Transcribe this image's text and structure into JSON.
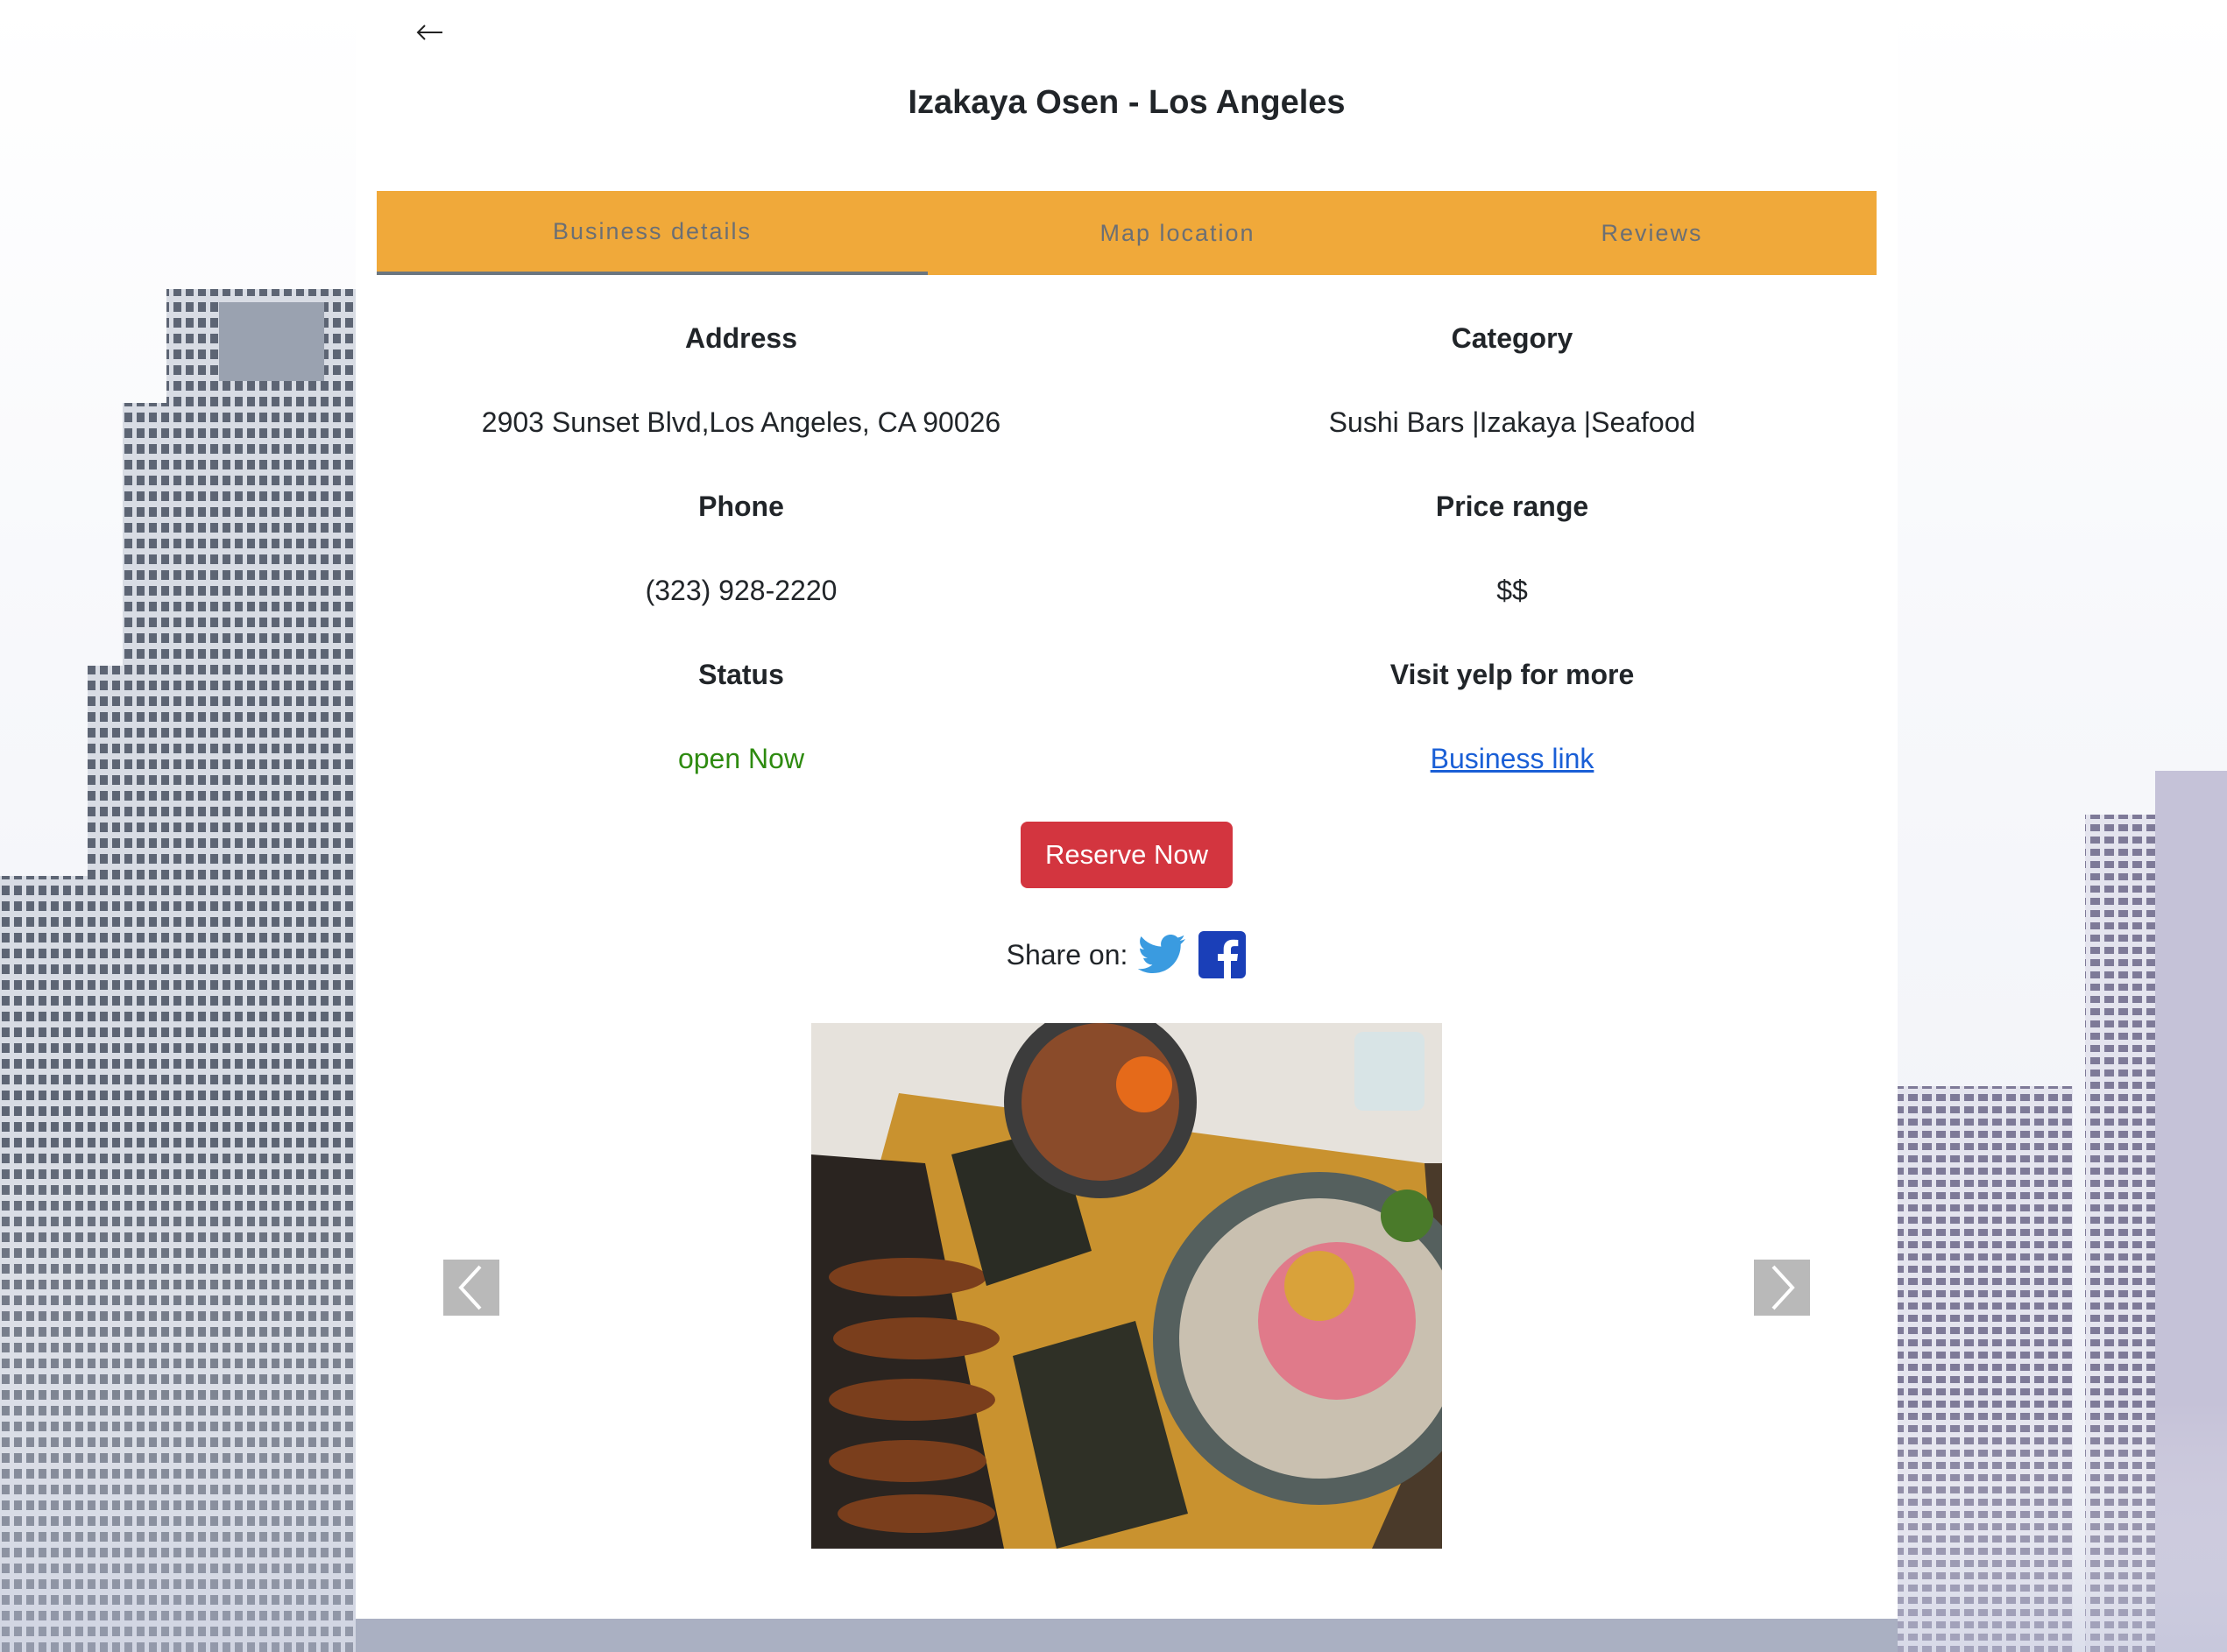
{
  "header": {
    "back_icon": "arrow-left-icon",
    "title": "Izakaya Osen - Los Angeles"
  },
  "tabs": [
    {
      "label": "Business details",
      "active": true
    },
    {
      "label": "Map location",
      "active": false
    },
    {
      "label": "Reviews",
      "active": false
    }
  ],
  "details": {
    "address_label": "Address",
    "address_value": "2903 Sunset Blvd,Los Angeles, CA 90026",
    "category_label": "Category",
    "category_value": "Sushi Bars |Izakaya |Seafood",
    "phone_label": "Phone",
    "phone_value": "(323) 928-2220",
    "price_label": "Price range",
    "price_value": "$$",
    "status_label": "Status",
    "status_value": "open Now",
    "status_color": "#2e8b10",
    "yelp_label": "Visit yelp for more",
    "yelp_link_text": "Business link"
  },
  "actions": {
    "reserve_label": "Reserve Now",
    "reserve_color": "#d3353f",
    "share_label": "Share on:",
    "share_icons": [
      "twitter-icon",
      "facebook-icon"
    ]
  },
  "carousel": {
    "prev_icon": "chevron-left-icon",
    "next_icon": "chevron-right-icon"
  },
  "colors": {
    "tab_bar": "#f0a93a",
    "link": "#1a5fd6"
  }
}
